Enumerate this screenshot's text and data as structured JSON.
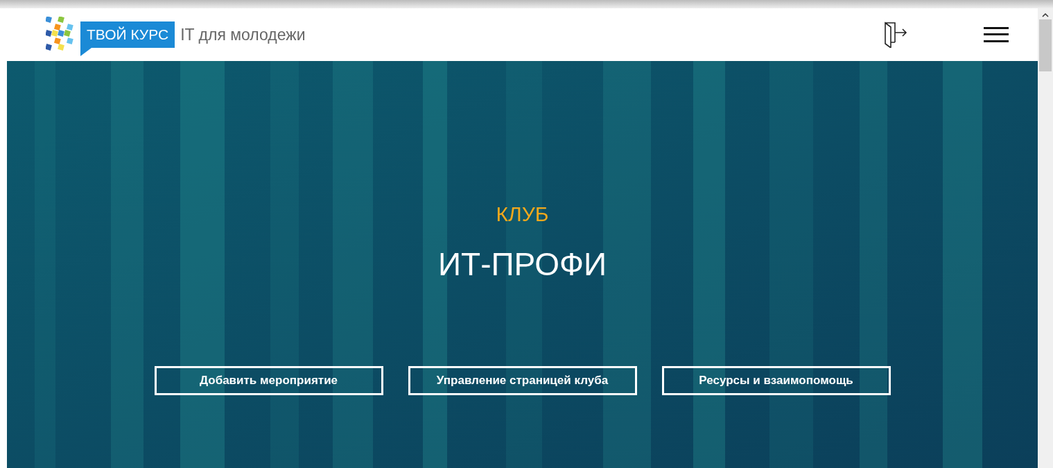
{
  "header": {
    "brand": "ТВОЙ КУРС",
    "tagline": "IT для молодежи"
  },
  "hero": {
    "kicker": "КЛУБ",
    "title": "ИТ-ПРОФИ",
    "buttons": [
      "Добавить мероприятие",
      "Управление страницей клуба",
      "Ресурсы и взаимопомощь"
    ]
  }
}
